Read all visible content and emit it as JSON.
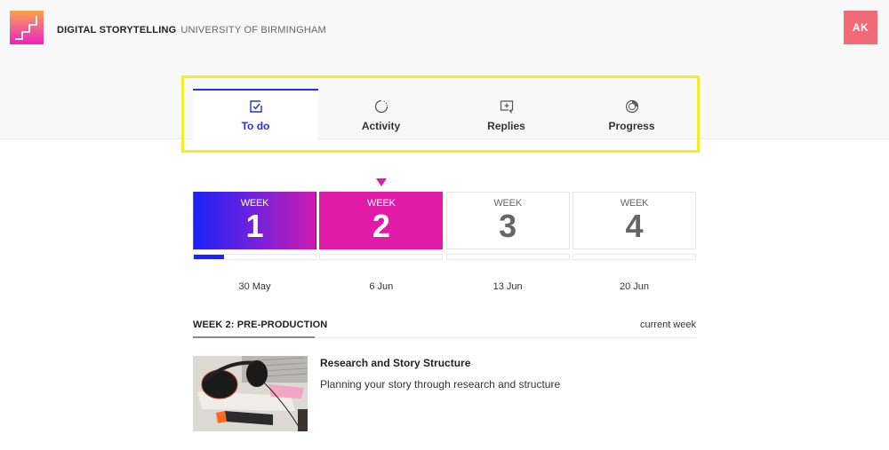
{
  "header": {
    "app_name": "DIGITAL STORYTELLING",
    "organization": "UNIVERSITY OF BIRMINGHAM",
    "avatar_initials": "AK",
    "logo_icon": "stairs-logo-icon"
  },
  "tabs": [
    {
      "label": "To do",
      "icon": "checkbox-icon",
      "active": true
    },
    {
      "label": "Activity",
      "icon": "spinner-icon",
      "active": false
    },
    {
      "label": "Replies",
      "icon": "comment-plus-icon",
      "active": false
    },
    {
      "label": "Progress",
      "icon": "progress-ring-icon",
      "active": false
    }
  ],
  "weeks": [
    {
      "prefix": "WEEK",
      "number": "1",
      "date": "30 May",
      "state": "past",
      "progress_percent": 25
    },
    {
      "prefix": "WEEK",
      "number": "2",
      "date": "6 Jun",
      "state": "current",
      "progress_percent": 0
    },
    {
      "prefix": "WEEK",
      "number": "3",
      "date": "13 Jun",
      "state": "future",
      "progress_percent": 0
    },
    {
      "prefix": "WEEK",
      "number": "4",
      "date": "20 Jun",
      "state": "future",
      "progress_percent": 0
    }
  ],
  "section": {
    "title": "WEEK 2: PRE-PRODUCTION",
    "meta": "current week"
  },
  "activities": [
    {
      "title": "Research and Story Structure",
      "description": "Planning your story through research and structure",
      "thumbnail": "headphones-desk-photo"
    }
  ],
  "colors": {
    "accent_blue": "#2a2ee6",
    "accent_magenta": "#e11aa8",
    "avatar_bg": "#f06a78",
    "highlight": "#f4ee2a"
  }
}
